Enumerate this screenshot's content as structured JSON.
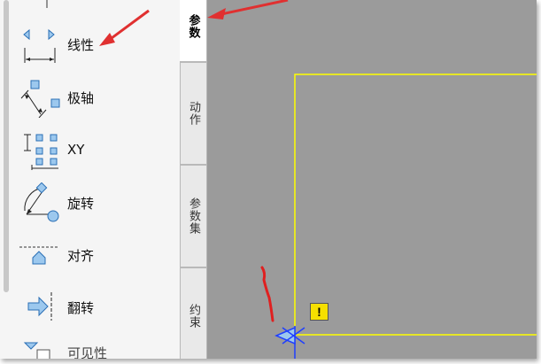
{
  "palette": {
    "items": [
      {
        "label": "线性",
        "icon": "linear-dimension-icon"
      },
      {
        "label": "极轴",
        "icon": "polar-icon"
      },
      {
        "label": "XY",
        "icon": "xy-icon"
      },
      {
        "label": "旋转",
        "icon": "rotation-icon"
      },
      {
        "label": "对齐",
        "icon": "alignment-icon"
      },
      {
        "label": "翻转",
        "icon": "flip-icon"
      },
      {
        "label": "可见性",
        "icon": "visibility-icon"
      }
    ]
  },
  "tabs": [
    {
      "label": "参数",
      "active": true
    },
    {
      "label": "动作",
      "active": false
    },
    {
      "label": "参数集",
      "active": false
    },
    {
      "label": "约束",
      "active": false
    }
  ],
  "canvas": {
    "background": "#9b9b9b",
    "rectangle_color": "#ffff00",
    "warning_symbol": "!"
  },
  "annotations": {
    "arrow_color": "#e03030",
    "scribble_color": "#e02020"
  }
}
